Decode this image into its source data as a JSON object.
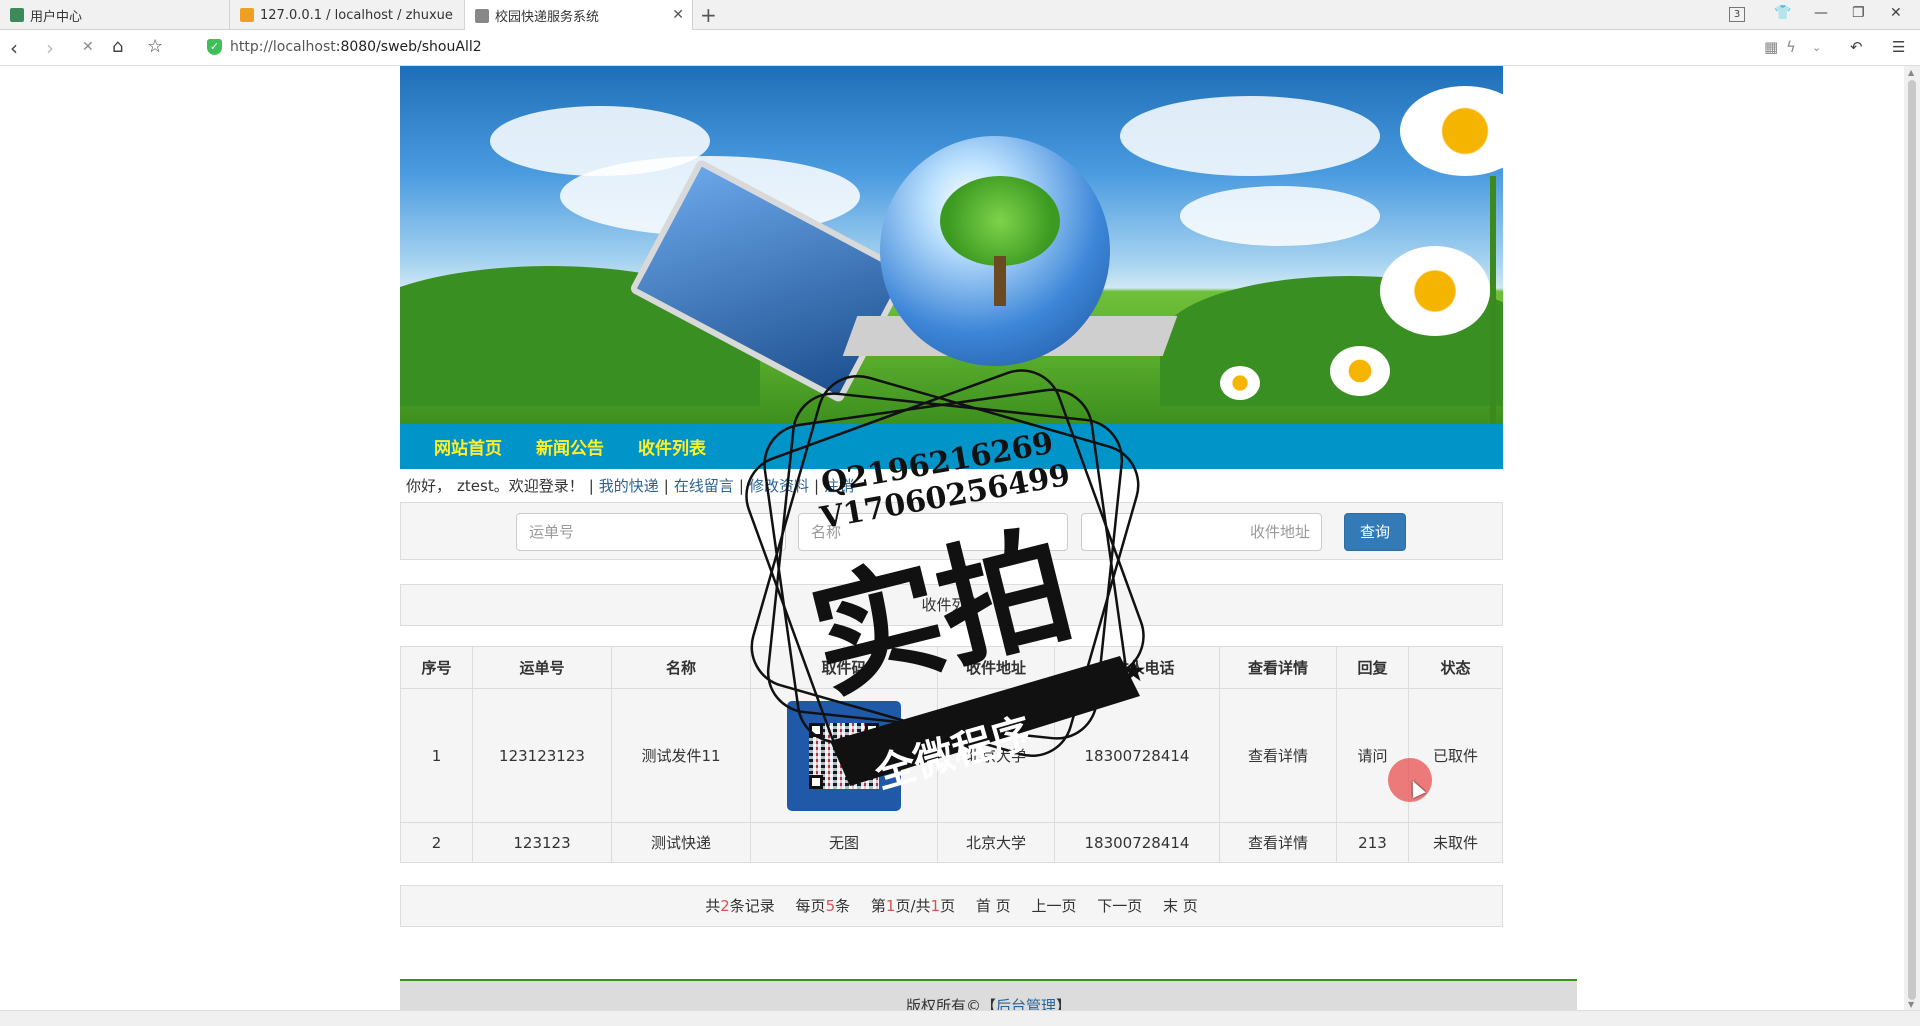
{
  "browser": {
    "tabs": [
      {
        "title": "用户中心",
        "favicon": "#3c8a5a"
      },
      {
        "title": "127.0.0.1 / localhost / zhuxue",
        "favicon": "#f0a020"
      },
      {
        "title": "校园快递服务系统",
        "favicon": "#888888"
      }
    ],
    "tab_count_badge": "3",
    "url_host": "http://localhost",
    "url_path": ":8080/sweb/shouAll2"
  },
  "site": {
    "nav": [
      "网站首页",
      "新闻公告",
      "收件列表"
    ],
    "welcome": {
      "greeting": "你好，",
      "username": "ztest",
      "suffix": "。欢迎登录！",
      "links": [
        "我的快递",
        "在线留言",
        "修改资料",
        "注销"
      ]
    },
    "search": {
      "waybill_placeholder": "运单号",
      "name_placeholder": "名称",
      "address_placeholder": "收件地址",
      "button": "查询"
    },
    "panel_title": "收件列表",
    "table": {
      "headers": [
        "序号",
        "运单号",
        "名称",
        "取件码",
        "收件地址",
        "收件人电话",
        "查看详情",
        "回复",
        "状态"
      ],
      "rows": [
        {
          "no": "1",
          "waybill": "123123123",
          "name": "测试发件11",
          "code": "qr-image",
          "address": "北京大学",
          "phone": "18300728414",
          "detail": "查看详情",
          "reply": "请问",
          "status": "已取件"
        },
        {
          "no": "2",
          "waybill": "123123",
          "name": "测试快递",
          "code": "无图",
          "address": "北京大学",
          "phone": "18300728414",
          "detail": "查看详情",
          "reply": "213",
          "status": "未取件"
        }
      ]
    },
    "pager": {
      "total_pre": "共",
      "total": "2",
      "total_post": "条记录",
      "per_pre": "每页",
      "per": "5",
      "per_post": "条",
      "page_pre": "第",
      "page": "1",
      "page_mid": "页/共",
      "pages": "1",
      "page_post": "页",
      "first": "首 页",
      "prev": "上一页",
      "next": "下一页",
      "last": "末 页"
    },
    "footer": {
      "text": "版权所有©【",
      "link": "后台管理",
      "end": "】"
    }
  },
  "watermark": {
    "line1": "Q2196216269",
    "line2": "V17060256499",
    "big": "实拍",
    "banner": "全微程序"
  },
  "colors": {
    "nav_bg": "#0094c8",
    "nav_text": "#ffef2a",
    "button": "#337ab7",
    "link": "#2a6496"
  }
}
